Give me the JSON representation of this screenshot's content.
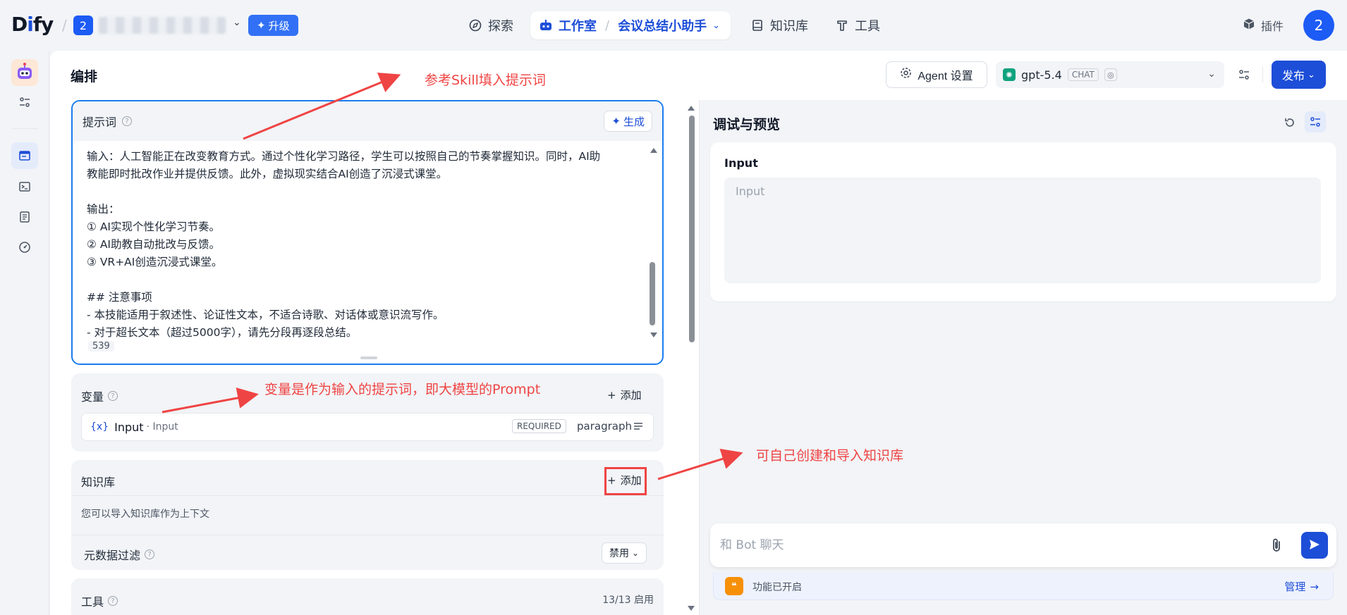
{
  "header": {
    "logo": "Dify",
    "workspace_badge": "2",
    "upgrade_label": "升级",
    "nav": {
      "explore": "探索",
      "studio": "工作室",
      "app_name": "会议总结小助手",
      "knowledge": "知识库",
      "tools": "工具"
    },
    "plugins": "插件",
    "avatar": "2"
  },
  "page": {
    "title": "编排",
    "agent_settings": "Agent 设置",
    "model": {
      "name": "gpt-5.4",
      "tag": "CHAT"
    },
    "publish": "发布"
  },
  "prompt": {
    "title": "提示词",
    "generate": "生成",
    "lines": [
      "输入：人工智能正在改变教育方式。通过个性化学习路径，学生可以按照自己的节奏掌握知识。同时，AI助",
      "教能即时批改作业并提供反馈。此外，虚拟现实结合AI创造了沉浸式课堂。",
      "",
      "输出：",
      "① AI实现个性化学习节奏。",
      "② AI助教自动批改与反馈。",
      "③ VR+AI创造沉浸式课堂。",
      "",
      "## 注意事项",
      "- 本技能适用于叙述性、论证性文本，不适合诗歌、对话体或意识流写作。",
      "- 对于超长文本（超过5000字），请先分段再逐段总结。"
    ],
    "char_count": "539"
  },
  "variables": {
    "title": "变量",
    "add": "添加",
    "items": [
      {
        "icon": "{x}",
        "name": "Input",
        "label": "· Input",
        "required": "REQUIRED",
        "type": "paragraph"
      }
    ]
  },
  "knowledge": {
    "title": "知识库",
    "add": "添加",
    "hint": "您可以导入知识库作为上下文",
    "metadata_filter": "元数据过滤",
    "filter_value": "禁用"
  },
  "tools": {
    "title": "工具",
    "count": "13/13 启用"
  },
  "preview": {
    "title": "调试与预览",
    "input_label": "Input",
    "input_placeholder": "Input",
    "chat_placeholder": "和 Bot 聊天",
    "feature_text": "功能已开启",
    "manage": "管理"
  },
  "annotations": {
    "skill": "参考Skill填入提示词",
    "variable": "变量是作为输入的提示词，即大模型的Prompt",
    "knowledge": "可自己创建和导入知识库"
  },
  "colors": {
    "accent": "#1d4ed8",
    "annotation": "#ef4444",
    "prompt_border": "#1a7df0"
  }
}
